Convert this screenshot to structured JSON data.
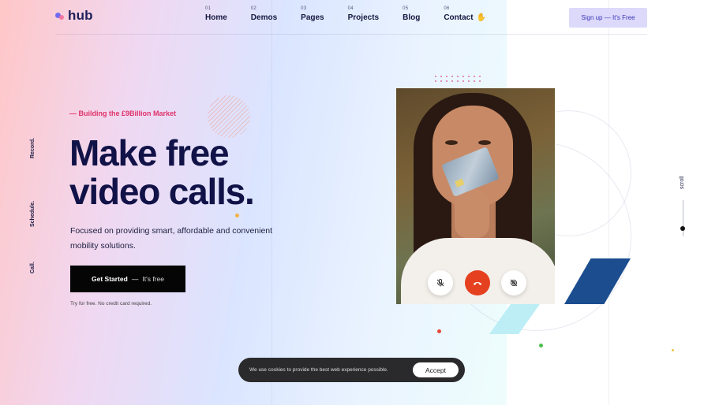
{
  "brand": {
    "logo_text": "hub",
    "accent": "#6f6cf2",
    "secondary_accent": "#f56b9c"
  },
  "nav": {
    "items": [
      {
        "num": "01",
        "label": "Home"
      },
      {
        "num": "02",
        "label": "Demos"
      },
      {
        "num": "03",
        "label": "Pages"
      },
      {
        "num": "04",
        "label": "Projects"
      },
      {
        "num": "05",
        "label": "Blog"
      },
      {
        "num": "06",
        "label": "Contact"
      }
    ],
    "contact_icon": "waving-hand-icon"
  },
  "header": {
    "signup_label": "Sign up — It's Free"
  },
  "side_nav": {
    "items": [
      "Record.",
      "Schedule.",
      "Call."
    ]
  },
  "hero": {
    "tagline": "— Building the £9Billion Market",
    "headline_line1": "Make free",
    "headline_line2": "video calls.",
    "subtext": "Focused on providing smart, affordable and convenient mobility solutions.",
    "cta_main": "Get Started",
    "cta_sep": "—",
    "cta_free": "It's free",
    "trial_note": "Try for free. No credit card required.",
    "tagline_color": "#e0336a",
    "headline_color": "#111247"
  },
  "call_controls": [
    {
      "name": "mute-microphone",
      "icon": "microphone-off-icon"
    },
    {
      "name": "end-call",
      "icon": "phone-hangup-icon",
      "color": "#e5401f"
    },
    {
      "name": "camera-off",
      "icon": "video-off-icon"
    }
  ],
  "scroll": {
    "label": "scroll"
  },
  "cookie": {
    "text": "We use cookies to provide the best web experience possible.",
    "accept_label": "Accept"
  }
}
